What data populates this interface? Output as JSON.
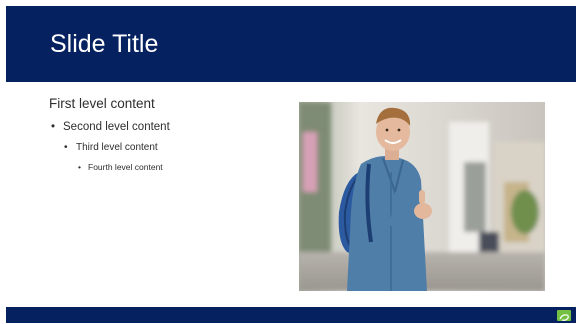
{
  "slide": {
    "title": "Slide Title",
    "content": {
      "level1": "First level content",
      "level2": "Second level content",
      "level3": "Third level content",
      "level4": "Fourth level content"
    },
    "bullet_glyph": "•"
  },
  "image": {
    "icon": "thumbs-up-student-photo"
  },
  "colors": {
    "title_bar": "#06215f",
    "bottom_bar": "#06215f",
    "logo_accent": "#74c043",
    "text": "#2e2e2e"
  },
  "logo": {
    "icon": "brand-logo-icon"
  }
}
